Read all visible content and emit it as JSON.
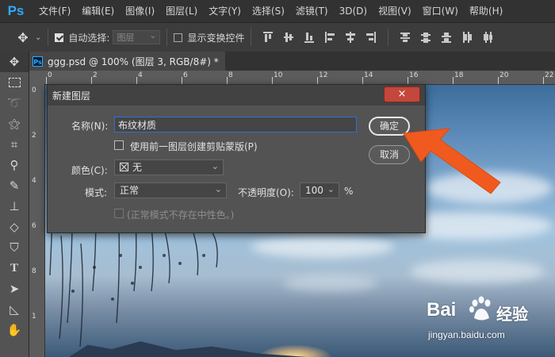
{
  "app": {
    "logo": "Ps",
    "menu": [
      "文件(F)",
      "编辑(E)",
      "图像(I)",
      "图层(L)",
      "文字(Y)",
      "选择(S)",
      "滤镜(T)",
      "3D(D)",
      "视图(V)",
      "窗口(W)",
      "帮助(H)"
    ]
  },
  "options_bar": {
    "auto_select_label": "自动选择:",
    "auto_select_checked": true,
    "auto_select_target": "图层",
    "show_transform_label": "显示变换控件",
    "show_transform_checked": false
  },
  "document": {
    "tab_title": "ggg.psd @ 100% (图层 3, RGB/8#) *",
    "tab_close": "×",
    "ruler_top_ticks": [
      "0",
      "2",
      "4",
      "6",
      "8",
      "10",
      "12",
      "14",
      "16",
      "18",
      "20",
      "22",
      "2"
    ],
    "ruler_left_ticks": [
      "0",
      "2",
      "4",
      "6",
      "8",
      "1"
    ]
  },
  "dialog": {
    "title": "新建图层",
    "close": "×",
    "name_label": "名称(N):",
    "name_value": "布纹材质",
    "clip_label": "使用前一图层创建剪贴蒙版(P)",
    "color_label": "颜色(C):",
    "color_value": "无",
    "mode_label": "模式:",
    "mode_value": "正常",
    "opacity_label": "不透明度(O):",
    "opacity_value": "100",
    "opacity_unit": "%",
    "neutral_label": "(正常模式不存在中性色。)",
    "ok_label": "确定",
    "cancel_label": "取消"
  },
  "watermark": {
    "brand": "Bai",
    "brand_suffix": "经验",
    "url": "jingyan.baidu.com"
  },
  "colors": {
    "dialog_bg": "#535353",
    "close_button": "#c4473b",
    "annotation_arrow": "#f05a1e",
    "ps_blue": "#31a8ff"
  }
}
